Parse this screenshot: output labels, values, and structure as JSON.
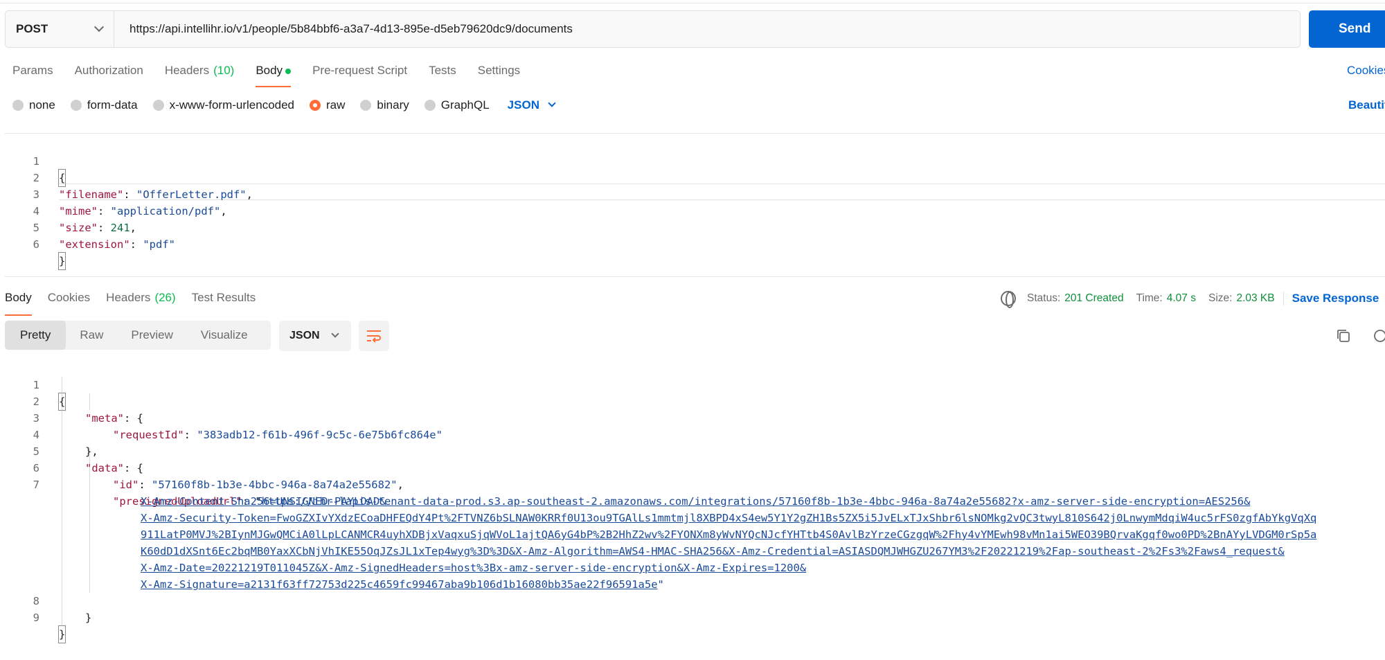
{
  "request": {
    "method": "POST",
    "url": "https://api.intellihr.io/v1/people/5b84bbf6-a3a7-4d13-895e-d5eb79620dc9/documents",
    "send_label": "Send"
  },
  "request_tabs": {
    "params": "Params",
    "authorization": "Authorization",
    "headers": "Headers",
    "headers_count": "(10)",
    "body": "Body",
    "pre_request": "Pre-request Script",
    "tests": "Tests",
    "settings": "Settings",
    "cookies": "Cookies"
  },
  "body_options": {
    "none": "none",
    "form_data": "form-data",
    "urlencoded": "x-www-form-urlencoded",
    "raw": "raw",
    "binary": "binary",
    "graphql": "GraphQL",
    "language": "JSON",
    "beautify": "Beautify"
  },
  "request_body": {
    "lines": [
      {
        "n": "1",
        "text": "{"
      },
      {
        "n": "2",
        "key": "\"filename\"",
        "sep": ": ",
        "val": "\"OfferLetter.pdf\"",
        "end": ","
      },
      {
        "n": "3",
        "key": "\"mime\"",
        "sep": ": ",
        "val": "\"application/pdf\"",
        "end": ","
      },
      {
        "n": "4",
        "key": "\"size\"",
        "sep": ": ",
        "num": "241",
        "end": ","
      },
      {
        "n": "5",
        "key": "\"extension\"",
        "sep": ": ",
        "val": "\"pdf\"",
        "end": ""
      },
      {
        "n": "6",
        "text": "}"
      }
    ]
  },
  "response_tabs": {
    "body": "Body",
    "cookies": "Cookies",
    "headers": "Headers",
    "headers_count": "(26)",
    "test_results": "Test Results"
  },
  "response_status": {
    "status_label": "Status:",
    "status_value": "201 Created",
    "time_label": "Time:",
    "time_value": "4.07 s",
    "size_label": "Size:",
    "size_value": "2.03 KB",
    "save_response": "Save Response"
  },
  "view_modes": {
    "pretty": "Pretty",
    "raw": "Raw",
    "preview": "Preview",
    "visualize": "Visualize",
    "format": "JSON"
  },
  "response_body": {
    "l1": "{",
    "l2_key": "\"meta\"",
    "l2_end": ": {",
    "l3_key": "\"requestId\"",
    "l3_val": "\"383adb12-f61b-496f-9c5c-6e75b6fc864e\"",
    "l4": "},",
    "l5_key": "\"data\"",
    "l5_end": ": {",
    "l6_key": "\"id\"",
    "l6_val": "\"57160f8b-1b3e-4bbc-946a-8a74a2e55682\"",
    "l7_key": "\"presignedUploadUrl\"",
    "url_lines": [
      "https://ihr-lapis-tenant-data-prod.s3.ap-southeast-2.amazonaws.com/integrations/57160f8b-1b3e-4bbc-946a-8a74a2e55682?x-amz-server-side-encryption=AES256&",
      "X-Amz-Content-Sha256=UNSIGNED-PAYLOAD&",
      "X-Amz-Security-Token=FwoGZXIvYXdzECoaDHFEQdY4Pt%2FTVNZ6bSLNAW0KRRf0U13ou9TGAlLs1mmtmjl8XBPD4xS4ew5Y1Y2gZH1Bs5ZX5i5JvELxTJxShbr6lsNOMkg2vQC3twyL810S642j0LnwymMdqiW4uc5rFS0zgfAbYkgVqXq",
      "911LatP0MVJ%2BIynMJGwQMCiA0lLpLCANMCR4uyhXDBjxVaqxuSjqWVoL1ajtQA6yG4bP%2B2HhZ2wv%2FYONXm8yWvNYQcNJcfYHTtb4S0AvlBzYrzeCGzgqW%2Fhy4vYMEwh98vMn1ai5WEO39BQrvaKgqf0wo0PD%2BnAYyLVDGM0rSp5a",
      "K60dD1dXSnt6Ec2bqMB0YaxXCbNjVhIKE55OqJZsJL1xTep4wyg%3D%3D&X-Amz-Algorithm=AWS4-HMAC-SHA256&X-Amz-Credential=ASIASDQMJWHGZU267YM3%2F20221219%2Fap-southeast-2%2Fs3%2Faws4_request&",
      "X-Amz-Date=20221219T011045Z&X-Amz-SignedHeaders=host%3Bx-amz-server-side-encryption&X-Amz-Expires=1200&",
      "X-Amz-Signature=a2131f63ff72753d225c4659fc99467aba9b106d1b16080bb35ae22f96591a5e"
    ],
    "l8": "}",
    "l9": "}",
    "line_numbers": [
      "1",
      "2",
      "3",
      "4",
      "5",
      "6",
      "7",
      "8",
      "9"
    ]
  },
  "colors": {
    "accent": "#ff6c37",
    "primary": "#0265d2",
    "success": "#0cbb52"
  },
  "icons": {
    "method_dropdown": "chevron-down-icon",
    "globe": "globe-icon",
    "wrap": "wrap-lines-icon",
    "copy": "copy-icon",
    "search": "search-icon"
  }
}
